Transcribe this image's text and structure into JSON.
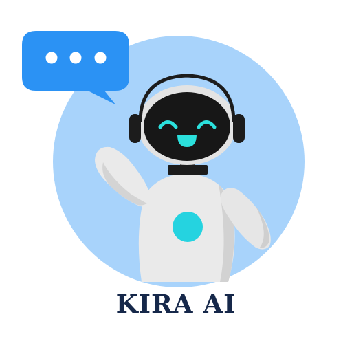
{
  "brand": {
    "name": "KIRA AI"
  },
  "colors": {
    "circle_background": "#a8d3fb",
    "chat_bubble": "#2b92f4",
    "chat_dots": "#ffffff",
    "robot_body": "#eaeaea",
    "robot_shadow": "#c8c8c8",
    "robot_face": "#171717",
    "face_features": "#2be0dc",
    "headphones": "#1c1c1c",
    "chest_light": "#25d3e0",
    "brand_text": "#16284a"
  },
  "icons": [
    "chat-bubble-icon",
    "robot-mascot-icon",
    "headphones-icon"
  ]
}
